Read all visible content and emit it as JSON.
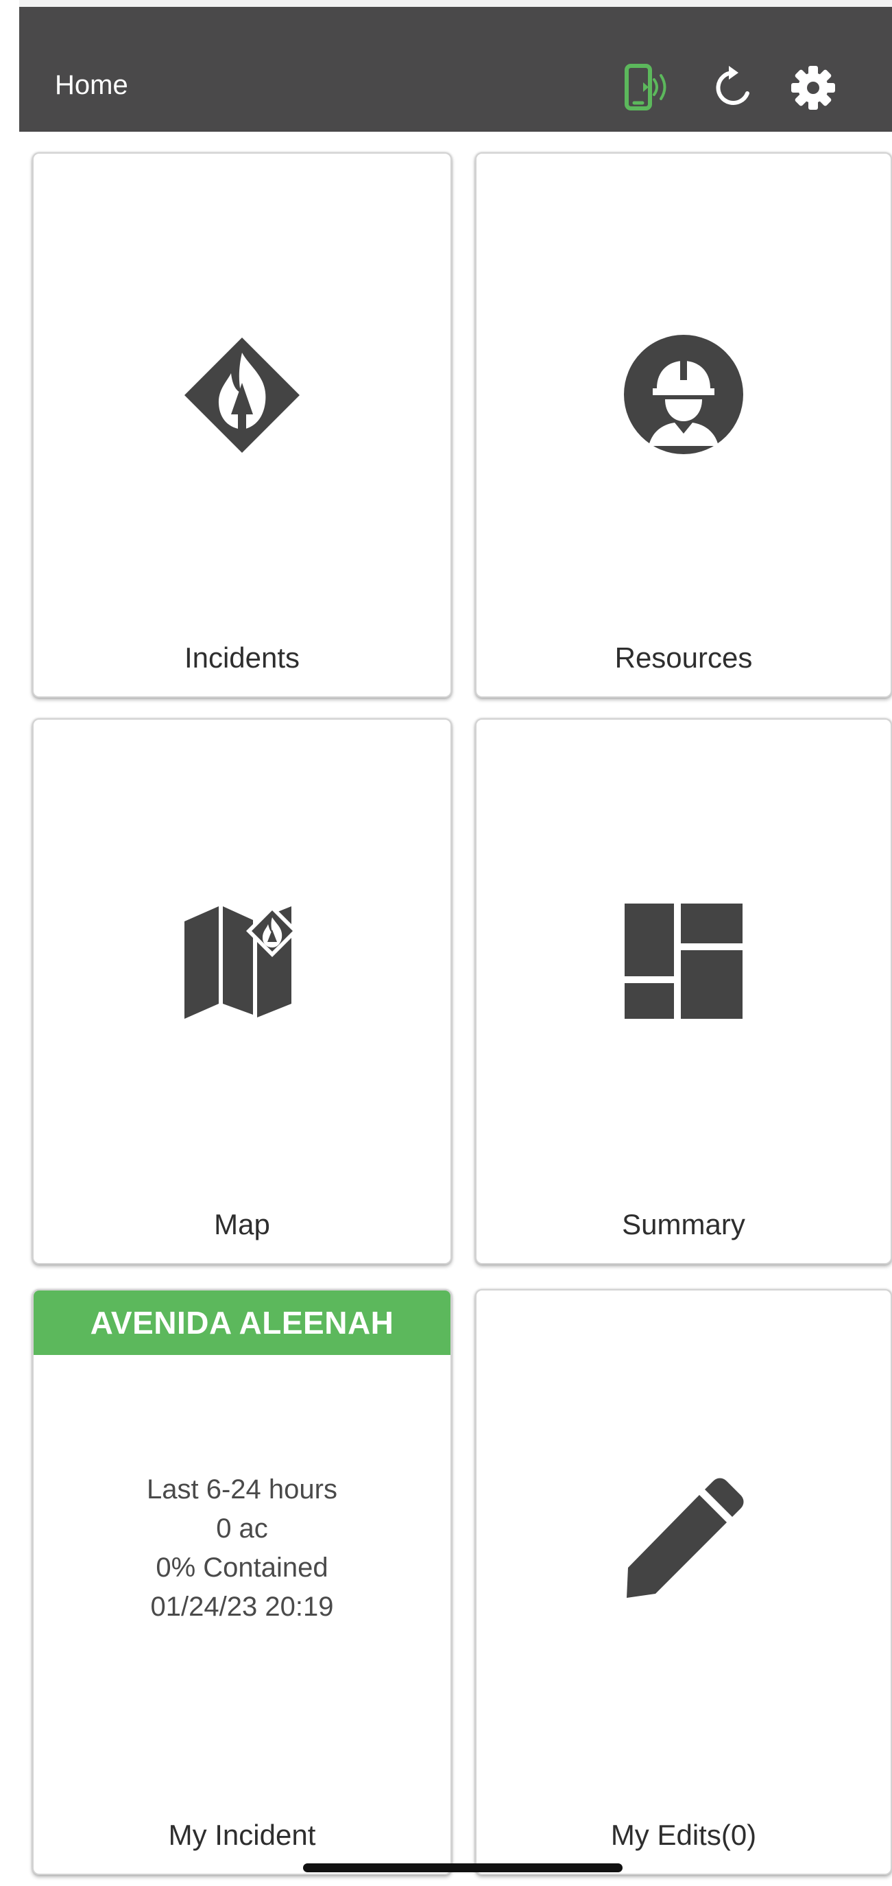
{
  "header": {
    "title": "Home",
    "icons": [
      "device-connected-icon",
      "refresh-icon",
      "settings-icon"
    ],
    "background_color": "#4a494a",
    "connected_color": "#5cb85c"
  },
  "tiles": {
    "incidents": {
      "label": "Incidents",
      "icon": "fire-diamond-icon"
    },
    "resources": {
      "label": "Resources",
      "icon": "firefighter-icon"
    },
    "map": {
      "label": "Map",
      "icon": "map-fire-icon"
    },
    "summary": {
      "label": "Summary",
      "icon": "dashboard-icon"
    },
    "my_incident": {
      "label": "My Incident",
      "banner": "AVENIDA ALEENAH",
      "banner_color": "#5cb85c",
      "period": "Last 6-24 hours",
      "acres": "0 ac",
      "containment": "0% Contained",
      "timestamp": "01/24/23 20:19"
    },
    "my_edits": {
      "label": "My Edits(0)",
      "icon": "pencil-icon"
    }
  },
  "icon_color": "#444444"
}
